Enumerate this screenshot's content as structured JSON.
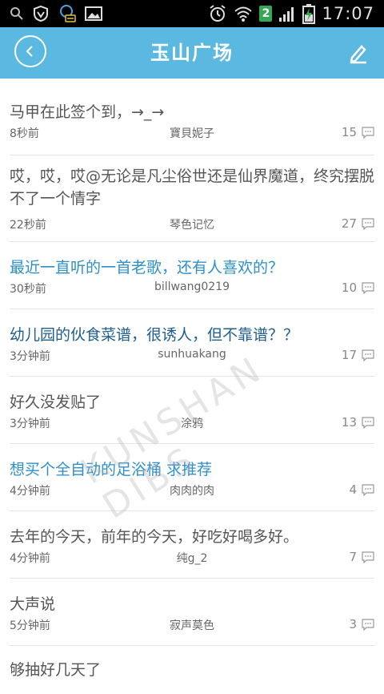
{
  "status_bar": {
    "time": "17:07",
    "sim_slot": "2",
    "left_icons": [
      "search-icon",
      "shield-icon",
      "chat-notification-icon",
      "image-icon"
    ],
    "right_icons": [
      "alarm-icon",
      "wifi-icon",
      "sim-badge",
      "signal-icon",
      "battery-charging-icon"
    ]
  },
  "header": {
    "title": "玉山广场",
    "background": "#5bb8e0"
  },
  "posts": [
    {
      "title": "马甲在此签个到，→_→",
      "time": "8秒前",
      "author": "寶貝妮子",
      "replies": "15",
      "style": "gray"
    },
    {
      "title": "哎，哎，哎@无论是凡尘俗世还是仙界魔道，终究摆脱不了一个情字",
      "time": "22秒前",
      "author": "琴色记忆",
      "replies": "27",
      "style": "gray"
    },
    {
      "title": "最近一直听的一首老歌，还有人喜欢的？",
      "time": "30秒前",
      "author": "billwang0219",
      "replies": "10",
      "style": "blue"
    },
    {
      "title": "幼儿园的伙食菜谱，很诱人，但不靠谱？？",
      "time": "3分钟前",
      "author": "sunhuakang",
      "replies": "17",
      "style": "dark"
    },
    {
      "title": "好久没发贴了",
      "time": "3分钟前",
      "author": "涂鸦",
      "replies": "13",
      "style": "gray"
    },
    {
      "title": "想买个全自动的足浴桶 求推荐",
      "time": "4分钟前",
      "author": "肉肉的肉",
      "replies": "4",
      "style": "blue"
    },
    {
      "title": "去年的今天，前年的今天，好吃好喝多好。",
      "time": "4分钟前",
      "author": "纯g_2",
      "replies": "7",
      "style": "gray"
    },
    {
      "title": "大声说",
      "time": "5分钟前",
      "author": "寂声莫色",
      "replies": "3",
      "style": "gray"
    },
    {
      "title": "够抽好几天了",
      "time": "",
      "author": "",
      "replies": "",
      "style": "gray"
    }
  ],
  "watermark": "KUNSHAN DIBS"
}
